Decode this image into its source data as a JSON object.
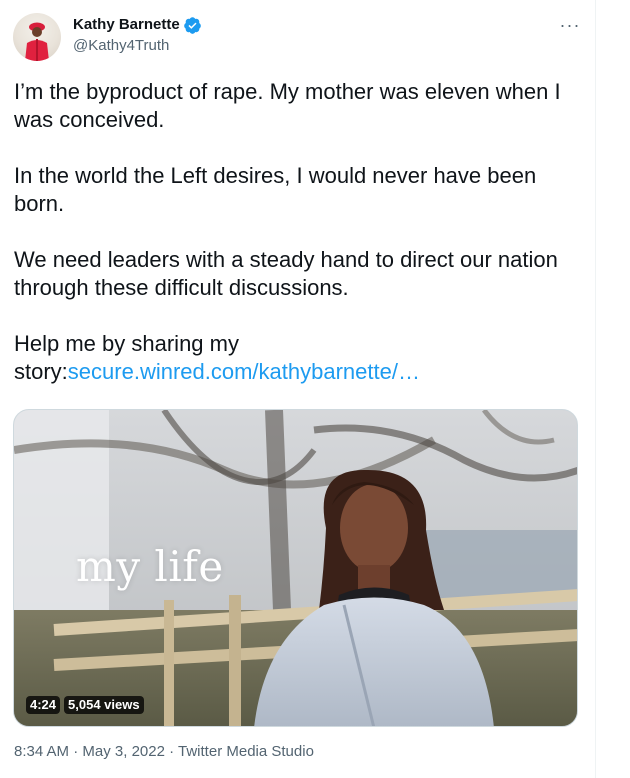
{
  "author": {
    "name": "Kathy Barnette",
    "handle": "@Kathy4Truth",
    "verified": true
  },
  "more_label": "···",
  "tweet": {
    "paragraphs": [
      "I’m the byproduct of rape. My mother was eleven when I was conceived.",
      "In the world the Left desires, I would never have been born.",
      "We need leaders with a steady hand to direct our nation through these difficult discussions."
    ],
    "last_prefix": "Help me by sharing my story:",
    "link_text": "secure.winred.com/kathybarnette/…"
  },
  "media": {
    "overlay_text": "my life",
    "duration": "4:24",
    "views": "5,054 views"
  },
  "meta": {
    "time": "8:34 AM",
    "sep1": " · ",
    "date": "May 3, 2022",
    "sep2": " · ",
    "source": "Twitter Media Studio"
  },
  "colors": {
    "link": "#1d9bf0",
    "secondary_text": "#536471",
    "verified_badge": "#1d9bf0"
  }
}
